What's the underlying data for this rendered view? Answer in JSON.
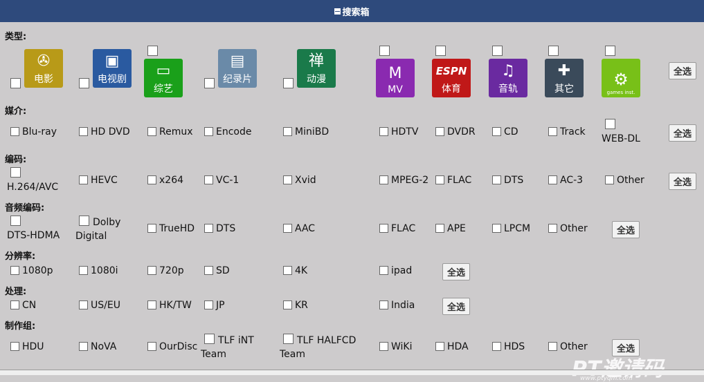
{
  "header": {
    "title": "搜索箱"
  },
  "rows": {
    "type": "类型:",
    "media": "媒介:",
    "codec": "编码:",
    "audio": "音频编码:",
    "resolution": "分辨率:",
    "processing": "处理:",
    "group": "制作组:"
  },
  "select_all": "全选",
  "categories": [
    {
      "label": "电影",
      "icon": "film-reel-icon",
      "color": "#b89a18"
    },
    {
      "label": "电视剧",
      "icon": "tv-icon",
      "color": "#2a5aa0"
    },
    {
      "label": "综艺",
      "icon": "variety-icon",
      "color": "#1aa01a"
    },
    {
      "label": "纪录片",
      "icon": "documentary-icon",
      "color": "#6a8aa8"
    },
    {
      "label": "动漫",
      "icon": "anime-icon",
      "color": "#1a7a4a"
    },
    {
      "label": "MV",
      "icon": "mtv-icon",
      "color": "#8a2ab0"
    },
    {
      "label": "体育",
      "icon": "espn-icon",
      "color": "#c01818"
    },
    {
      "label": "音轨",
      "icon": "music-note-icon",
      "color": "#6a2aa0"
    },
    {
      "label": "其它",
      "icon": "other-icon",
      "color": "#3a4a5a"
    },
    {
      "label": "games inst.",
      "icon": "gamepad-icon",
      "color": "#78c018"
    }
  ],
  "media": [
    "Blu-ray",
    "HD DVD",
    "Remux",
    "Encode",
    "MiniBD",
    "HDTV",
    "DVDR",
    "CD",
    "Track",
    "WEB-DL"
  ],
  "codec": [
    "H.264/AVC",
    "HEVC",
    "x264",
    "VC-1",
    "Xvid",
    "MPEG-2",
    "FLAC",
    "DTS",
    "AC-3",
    "Other"
  ],
  "audio": [
    "DTS-HDMA",
    "Dolby Digital",
    "TrueHD",
    "DTS",
    "AAC",
    "FLAC",
    "APE",
    "LPCM",
    "Other"
  ],
  "resolution": [
    "1080p",
    "1080i",
    "720p",
    "SD",
    "4K",
    "ipad"
  ],
  "processing": [
    "CN",
    "US/EU",
    "HK/TW",
    "JP",
    "KR",
    "India"
  ],
  "group": [
    "HDU",
    "NoVA",
    "OurDisc",
    "TLF iNT Team",
    "TLF HALFCD Team",
    "WiKi",
    "HDA",
    "HDS",
    "Other"
  ],
  "watermark": {
    "text": "PT邀请码",
    "url": "www.ptyqm.com"
  }
}
